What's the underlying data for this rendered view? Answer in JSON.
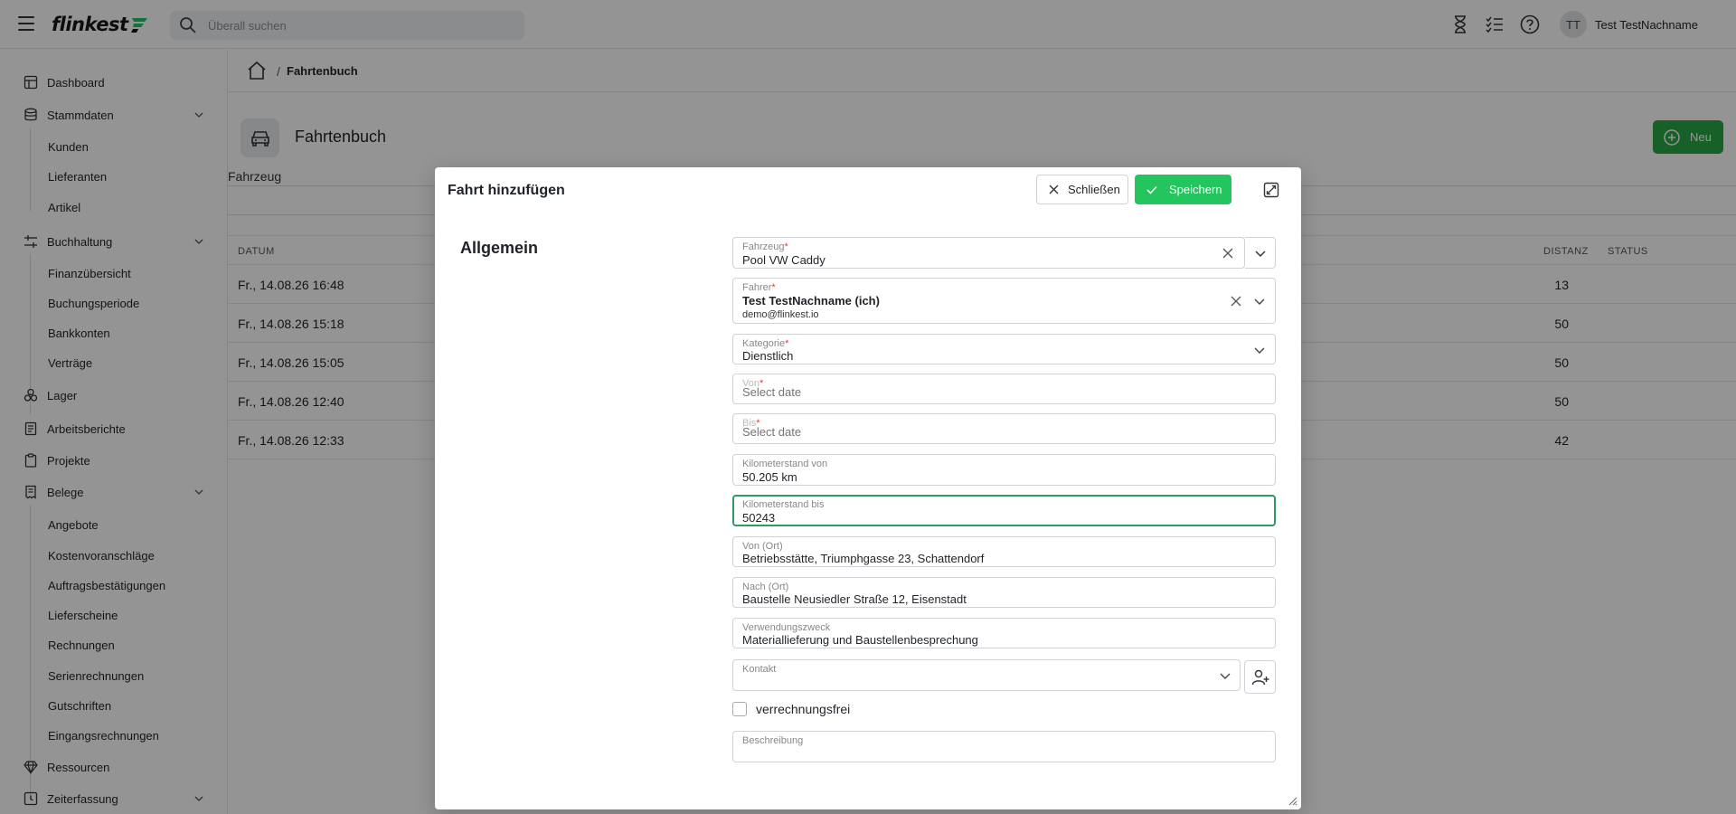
{
  "app": {
    "logo_text": "flinkest",
    "brand_color": "#22c55e"
  },
  "header": {
    "search_placeholder": "Überall suchen",
    "icons": [
      "hourglass-icon",
      "checklist-icon",
      "help-icon"
    ],
    "user_initials": "TT",
    "user_name": "Test TestNachname"
  },
  "sidebar": {
    "items": [
      {
        "label": "Dashboard",
        "icon": "dashboard-icon"
      },
      {
        "label": "Stammdaten",
        "icon": "database-icon",
        "expandable": true
      },
      {
        "label": "Kunden"
      },
      {
        "label": "Lieferanten"
      },
      {
        "label": "Artikel"
      },
      {
        "label": "Buchhaltung",
        "icon": "sliders-icon",
        "expandable": true
      },
      {
        "label": "Finanzübersicht"
      },
      {
        "label": "Buchungsperiode"
      },
      {
        "label": "Bankkonten"
      },
      {
        "label": "Verträge"
      },
      {
        "label": "Lager",
        "icon": "boxes-icon"
      },
      {
        "label": "Arbeitsberichte",
        "icon": "report-icon"
      },
      {
        "label": "Projekte",
        "icon": "clipboard-icon"
      },
      {
        "label": "Belege",
        "icon": "receipt-icon",
        "expandable": true
      },
      {
        "label": "Angebote"
      },
      {
        "label": "Kostenvoranschläge"
      },
      {
        "label": "Auftragsbestätigungen"
      },
      {
        "label": "Lieferscheine"
      },
      {
        "label": "Rechnungen"
      },
      {
        "label": "Serienrechnungen"
      },
      {
        "label": "Gutschriften"
      },
      {
        "label": "Eingangsrechnungen"
      },
      {
        "label": "Ressourcen",
        "icon": "diamond-icon"
      },
      {
        "label": "Zeiterfassung",
        "icon": "clock-icon",
        "expandable": true
      }
    ]
  },
  "breadcrumb": {
    "separator": "/",
    "current": "Fahrtenbuch"
  },
  "page": {
    "title": "Fahrtenbuch",
    "new_button": "Neu",
    "filter_label": "Fahrzeug"
  },
  "table": {
    "columns": [
      "DATUM",
      "DISTANZ",
      "STATUS"
    ],
    "rows": [
      {
        "date": "Fr., 14.08.26 16:48",
        "distance": "13"
      },
      {
        "date": "Fr., 14.08.26 15:18",
        "distance": "50"
      },
      {
        "date": "Fr., 14.08.26 15:05",
        "distance": "50"
      },
      {
        "date": "Fr., 14.08.26 12:40",
        "distance": "50"
      },
      {
        "date": "Fr., 14.08.26 12:33",
        "distance": "42"
      }
    ]
  },
  "modal": {
    "title": "Fahrt hinzufügen",
    "close_button": "Schließen",
    "save_button": "Speichern",
    "section_title": "Allgemein",
    "required_mark": "*",
    "fields": {
      "fahrzeug": {
        "label": "Fahrzeug",
        "value": "Pool VW Caddy"
      },
      "fahrer": {
        "label": "Fahrer",
        "value": "Test TestNachname (ich)",
        "email": "demo@flinkest.io"
      },
      "kategorie": {
        "label": "Kategorie",
        "value": "Dienstlich"
      },
      "von": {
        "label": "Von",
        "placeholder": "Select date"
      },
      "bis": {
        "label": "Bis",
        "placeholder": "Select date"
      },
      "km_von": {
        "label": "Kilometerstand von",
        "value": "50.205 km"
      },
      "km_bis": {
        "label": "Kilometerstand bis",
        "value": "50243"
      },
      "von_ort": {
        "label": "Von (Ort)",
        "value": "Betriebsstätte, Triumphgasse 23, Schattendorf"
      },
      "nach_ort": {
        "label": "Nach (Ort)",
        "value": "Baustelle Neusiedler Straße 12, Eisenstadt"
      },
      "zweck": {
        "label": "Verwendungszweck",
        "value": "Materiallieferung und Baustellenbesprechung"
      },
      "kontakt": {
        "label": "Kontakt",
        "value": ""
      },
      "verrechnungsfrei": {
        "label": "verrechnungsfrei",
        "checked": false
      },
      "beschreibung": {
        "label": "Beschreibung",
        "value": ""
      }
    }
  }
}
